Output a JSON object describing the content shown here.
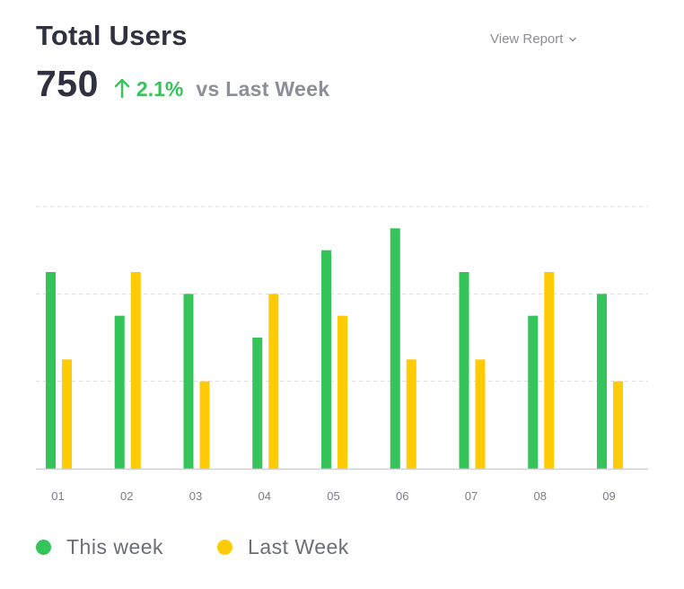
{
  "header": {
    "title": "Total Users",
    "view_report": "View Report",
    "value": "750",
    "delta": "2.1%",
    "compare": "vs Last Week"
  },
  "colors": {
    "this_week": "#35c459",
    "last_week": "#ffcb05",
    "delta": "#35c459"
  },
  "chart_data": {
    "type": "bar",
    "categories": [
      "01",
      "02",
      "03",
      "04",
      "05",
      "06",
      "07",
      "08",
      "09"
    ],
    "series": [
      {
        "name": "This week",
        "values": [
          9,
          7,
          8,
          6,
          10,
          11,
          9,
          7,
          8
        ]
      },
      {
        "name": "Last Week",
        "values": [
          5,
          9,
          4,
          8,
          7,
          5,
          5,
          9,
          4
        ]
      }
    ],
    "ylim": [
      0,
      12
    ],
    "grid": true,
    "legend": "bottom-left"
  }
}
